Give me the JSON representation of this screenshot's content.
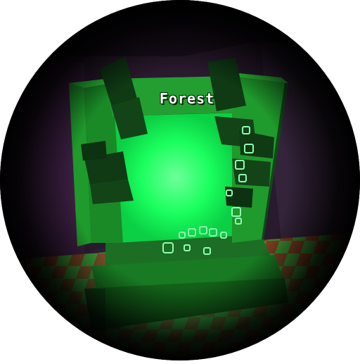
{
  "portal": {
    "label": "Forest"
  },
  "colors": {
    "portal_glow": "#1aff5e",
    "frame_green": "#1f9a2c",
    "frame_dark": "#0f4a16",
    "room_dark": "#2a1a2e",
    "floor_red": "#8a3a22"
  }
}
